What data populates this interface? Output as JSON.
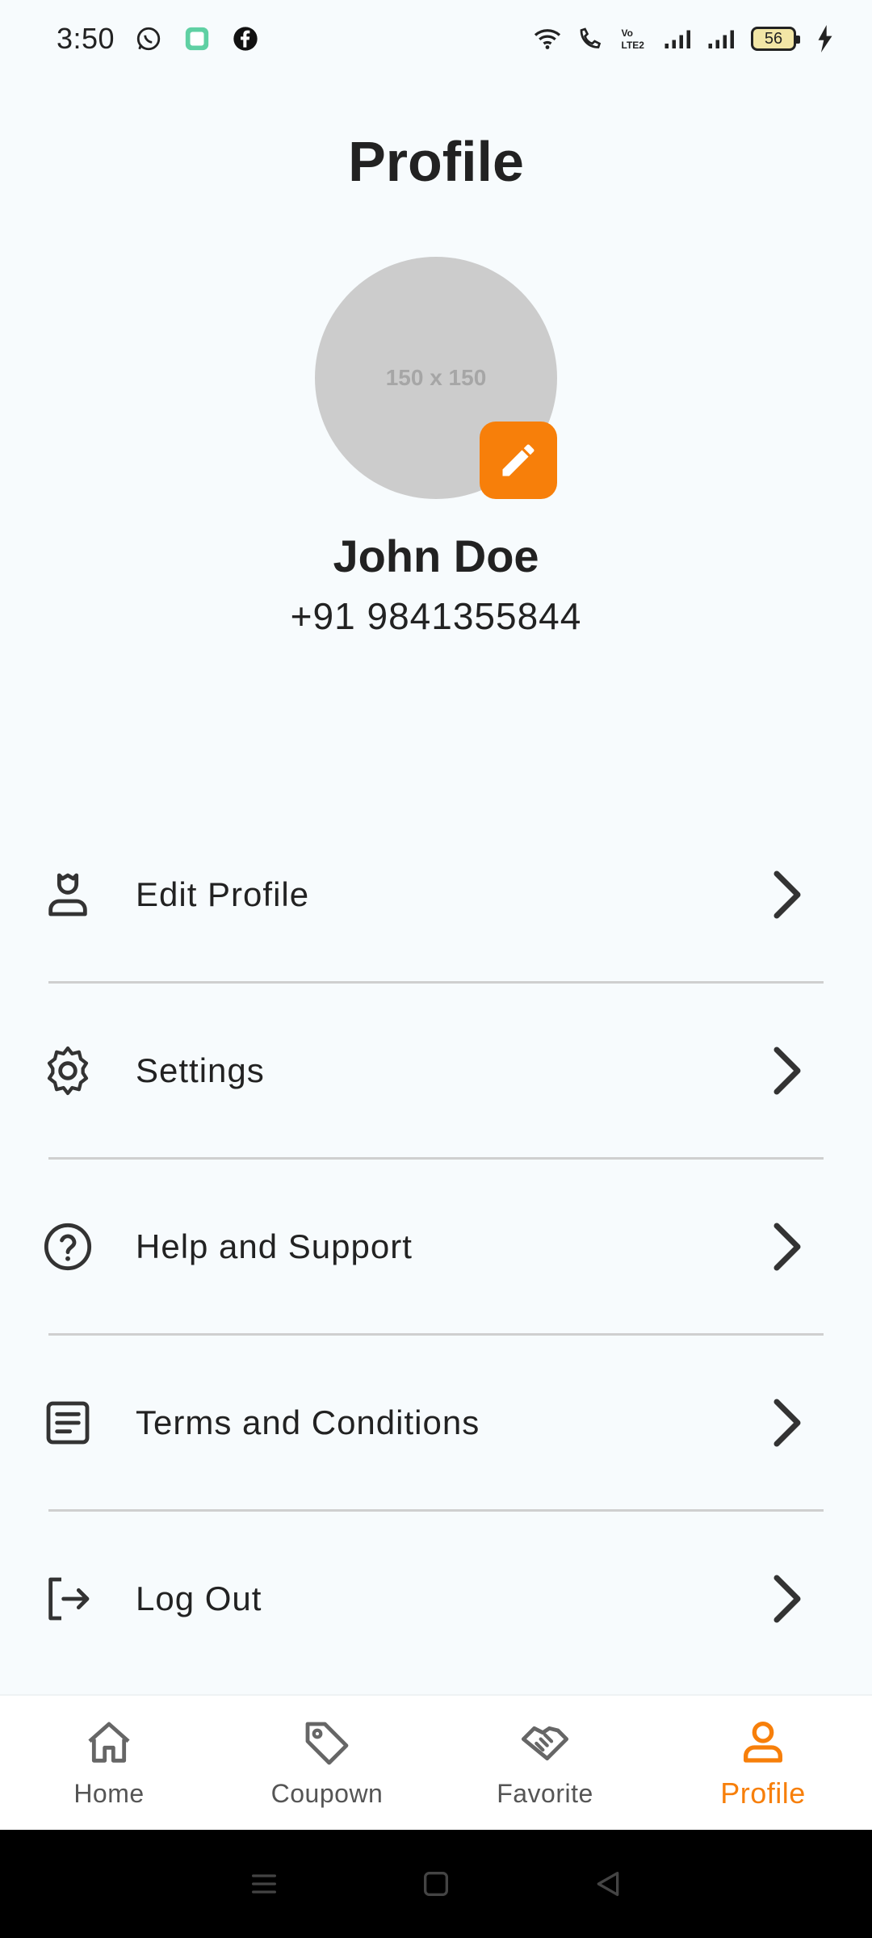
{
  "status_bar": {
    "time": "3:50",
    "battery_level": "56",
    "left_icons": [
      "whatsapp-icon",
      "app-notification-icon",
      "facebook-icon"
    ],
    "right_icons": [
      "wifi-icon",
      "wifi-calling-icon",
      "volte-icon",
      "signal-icon",
      "signal-icon",
      "battery-icon",
      "charging-icon"
    ]
  },
  "header": {
    "title": "Profile"
  },
  "profile": {
    "avatar_placeholder": "150 x 150",
    "name": "John Doe",
    "phone": "+91 9841355844"
  },
  "menu": {
    "items": [
      {
        "label": "Edit Profile",
        "icon": "user-edit-icon"
      },
      {
        "label": "Settings",
        "icon": "gear-icon"
      },
      {
        "label": "Help and Support",
        "icon": "help-circle-icon"
      },
      {
        "label": "Terms and Conditions",
        "icon": "document-icon"
      },
      {
        "label": "Log Out",
        "icon": "logout-icon"
      }
    ]
  },
  "bottom_nav": {
    "items": [
      {
        "label": "Home",
        "icon": "home-icon"
      },
      {
        "label": "Coupown",
        "icon": "tag-icon"
      },
      {
        "label": "Favorite",
        "icon": "handshake-icon"
      },
      {
        "label": "Profile",
        "icon": "user-icon",
        "active": true
      }
    ]
  },
  "colors": {
    "accent": "#f77f0a",
    "background": "#f7fbfd",
    "text": "#222222",
    "divider": "#cfcfcf"
  }
}
